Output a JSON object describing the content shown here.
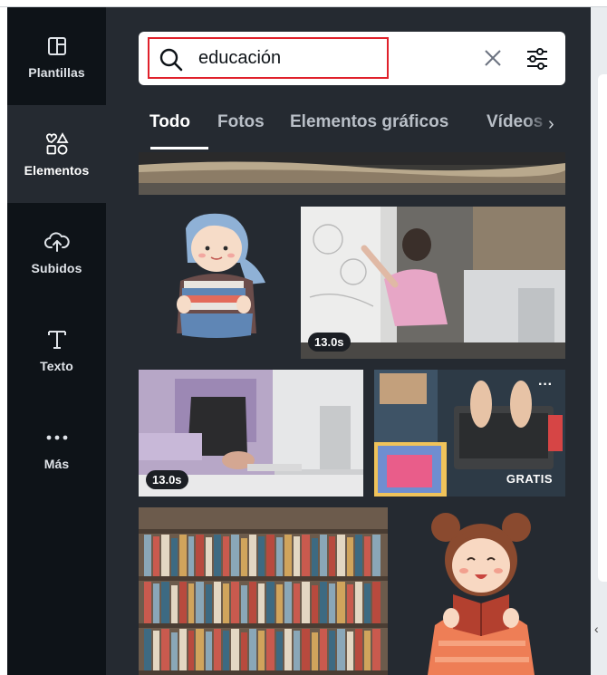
{
  "sidebar": {
    "items": [
      {
        "label": "Plantillas",
        "icon": "layout-icon"
      },
      {
        "label": "Elementos",
        "icon": "shapes-icon"
      },
      {
        "label": "Subidos",
        "icon": "cloud-upload-icon"
      },
      {
        "label": "Texto",
        "icon": "text-icon"
      },
      {
        "label": "Más",
        "icon": "more-dots-icon"
      }
    ],
    "active": "Elementos"
  },
  "search": {
    "value": "educación",
    "icon": "search-icon",
    "clear_icon": "close-icon",
    "filter_icon": "sliders-icon"
  },
  "tabs": [
    {
      "label": "Todo"
    },
    {
      "label": "Fotos"
    },
    {
      "label": "Elementos gráficos"
    },
    {
      "label": "Vídeos"
    }
  ],
  "active_tab": "Todo",
  "results": {
    "video_1": {
      "duration": "13.0s"
    },
    "video_2": {
      "duration": "13.0s"
    },
    "free_photo": {
      "badge": "GRATIS"
    }
  },
  "colors": {
    "rail_bg": "#0e1318",
    "panel_bg": "#252a31",
    "highlight_box": "#e0212b"
  }
}
